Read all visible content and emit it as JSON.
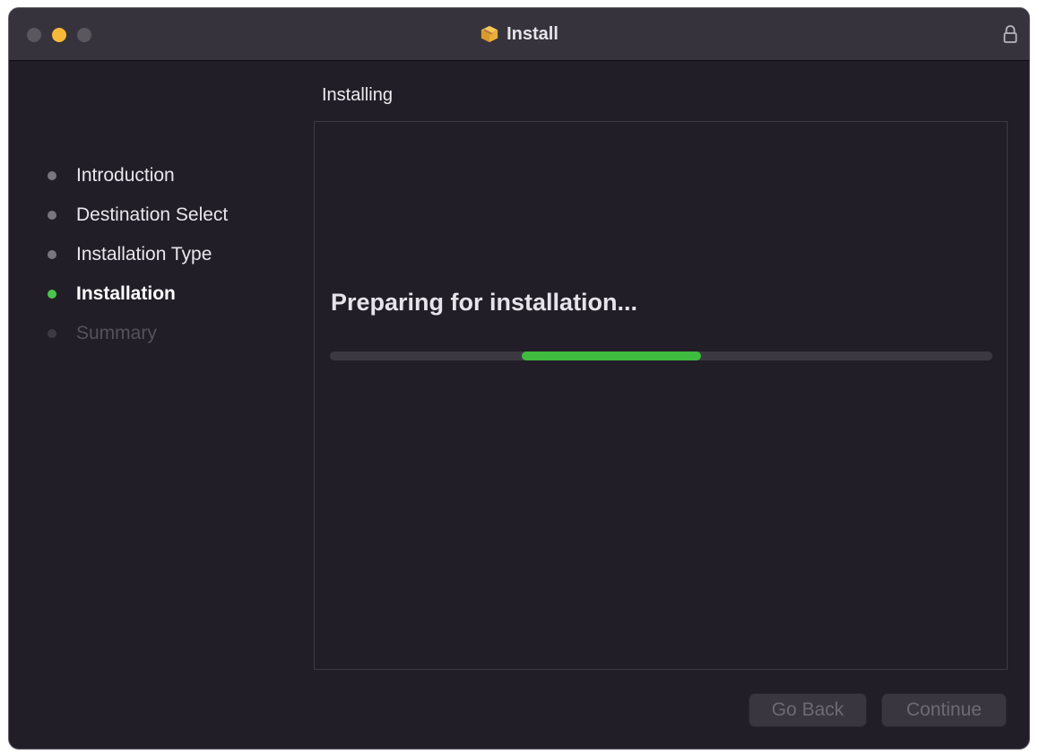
{
  "window": {
    "title": "Install"
  },
  "icons": {
    "title_icon": "package-icon",
    "lock": "lock-icon"
  },
  "sidebar": {
    "steps": [
      {
        "label": "Introduction",
        "state": "done"
      },
      {
        "label": "Destination Select",
        "state": "done"
      },
      {
        "label": "Installation Type",
        "state": "done"
      },
      {
        "label": "Installation",
        "state": "active"
      },
      {
        "label": "Summary",
        "state": "pending"
      }
    ]
  },
  "main": {
    "section_title": "Installing",
    "status_text": "Preparing for installation...",
    "progress": {
      "start_fraction": 0.29,
      "end_fraction": 0.56,
      "indeterminate": true
    }
  },
  "buttons": {
    "go_back": "Go Back",
    "continue": "Continue"
  },
  "colors": {
    "accent_green": "#3fbb3f",
    "window_bg": "#221e27",
    "minimize_yellow": "#f6b93a"
  }
}
